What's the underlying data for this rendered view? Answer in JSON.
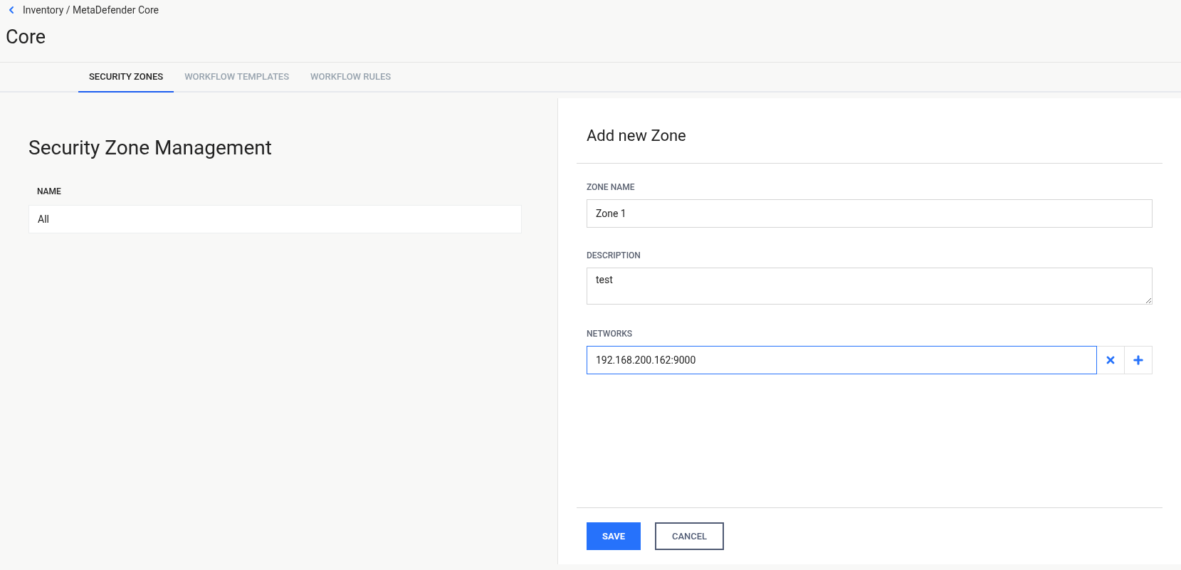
{
  "breadcrumb": "Inventory / MetaDefender Core",
  "page_title": "Core",
  "tabs": [
    {
      "label": "SECURITY ZONES",
      "selected": true
    },
    {
      "label": "WORKFLOW TEMPLATES",
      "selected": false
    },
    {
      "label": "WORKFLOW RULES",
      "selected": false
    }
  ],
  "zone_list": {
    "title": "Security Zone Management",
    "column": "NAME",
    "rows": [
      "All"
    ]
  },
  "form": {
    "title": "Add new Zone",
    "zone_name": {
      "label": "ZONE NAME",
      "value": "Zone 1"
    },
    "description": {
      "label": "DESCRIPTION",
      "value": "test"
    },
    "networks": {
      "label": "NETWORKS",
      "value": "192.168.200.162:9000"
    },
    "buttons": [
      {
        "label": "SAVE",
        "kind": "primary"
      },
      {
        "label": "CANCEL",
        "kind": "secondary"
      }
    ]
  }
}
